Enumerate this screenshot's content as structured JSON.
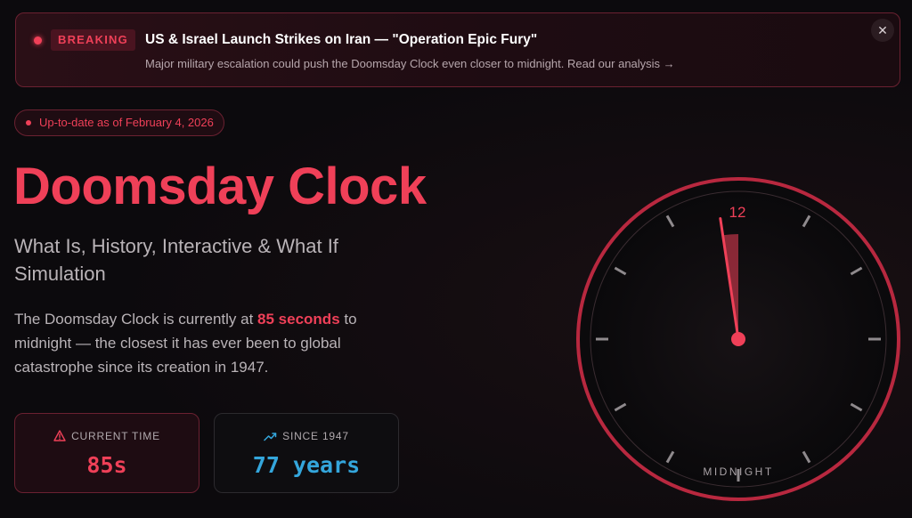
{
  "banner": {
    "badge": "BREAKING",
    "title": "US & Israel Launch Strikes on Iran — \"Operation Epic Fury\"",
    "subtitle": "Major military escalation could push the Doomsday Clock even closer to midnight. Read our analysis →",
    "close_icon": "✕"
  },
  "date_pill": {
    "text": "Up-to-date as of February 4, 2026"
  },
  "hero": {
    "title": "Doomsday Clock",
    "subtitle": "What Is, History, Interactive & What If Simulation",
    "desc_before": "The Doomsday Clock is currently at ",
    "desc_highlight": "85 seconds",
    "desc_after": " to midnight — the closest it has ever been to global catastrophe since its creation in 1947."
  },
  "stats": {
    "current": {
      "icon": "warning-triangle-icon",
      "label": "CURRENT TIME",
      "value": "85s"
    },
    "since": {
      "icon": "trending-up-icon",
      "label": "SINCE 1947",
      "value": "77 years"
    }
  },
  "clock": {
    "twelve_label": "12",
    "midnight_label": "MIDNIGHT",
    "seconds_to_midnight": 85
  },
  "colors": {
    "accent": "#ef4058",
    "blue": "#34a6dc",
    "background": "#0c0a0d"
  }
}
